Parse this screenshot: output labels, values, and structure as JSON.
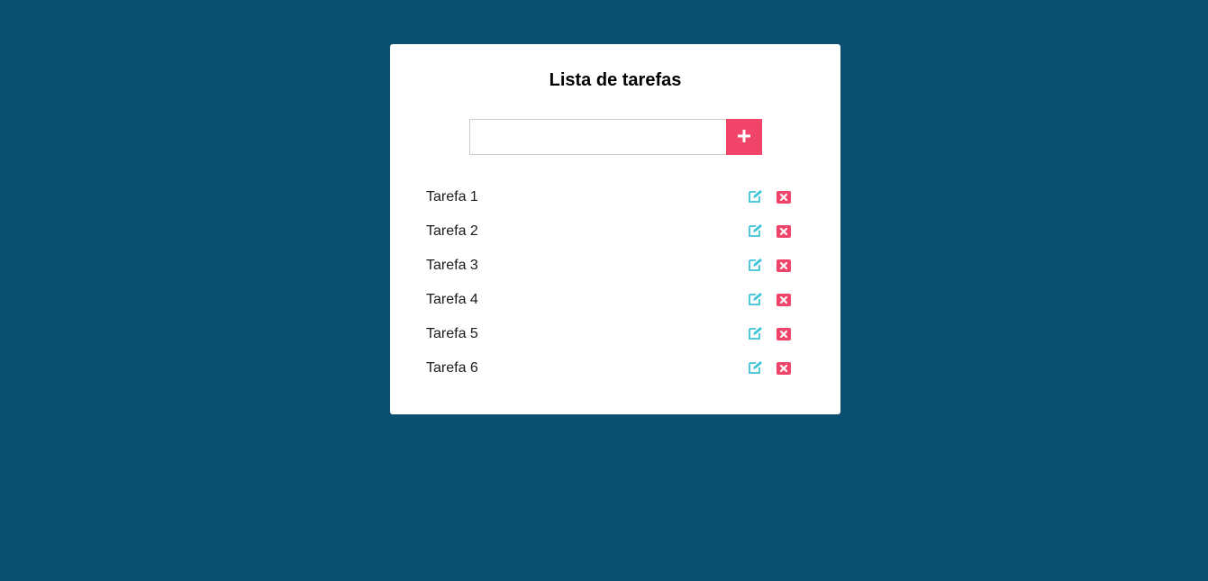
{
  "header": {
    "title": "Lista de tarefas"
  },
  "form": {
    "input_value": "",
    "input_placeholder": "",
    "add_icon": "plus-icon"
  },
  "colors": {
    "background": "#0b5070",
    "accent": "#f0446a",
    "edit": "#3cc3d8"
  },
  "tasks": [
    {
      "label": "Tarefa 1",
      "edit_icon": "edit-icon",
      "delete_icon": "delete-icon"
    },
    {
      "label": "Tarefa 2",
      "edit_icon": "edit-icon",
      "delete_icon": "delete-icon"
    },
    {
      "label": "Tarefa 3",
      "edit_icon": "edit-icon",
      "delete_icon": "delete-icon"
    },
    {
      "label": "Tarefa 4",
      "edit_icon": "edit-icon",
      "delete_icon": "delete-icon"
    },
    {
      "label": "Tarefa 5",
      "edit_icon": "edit-icon",
      "delete_icon": "delete-icon"
    },
    {
      "label": "Tarefa 6",
      "edit_icon": "edit-icon",
      "delete_icon": "delete-icon"
    }
  ]
}
